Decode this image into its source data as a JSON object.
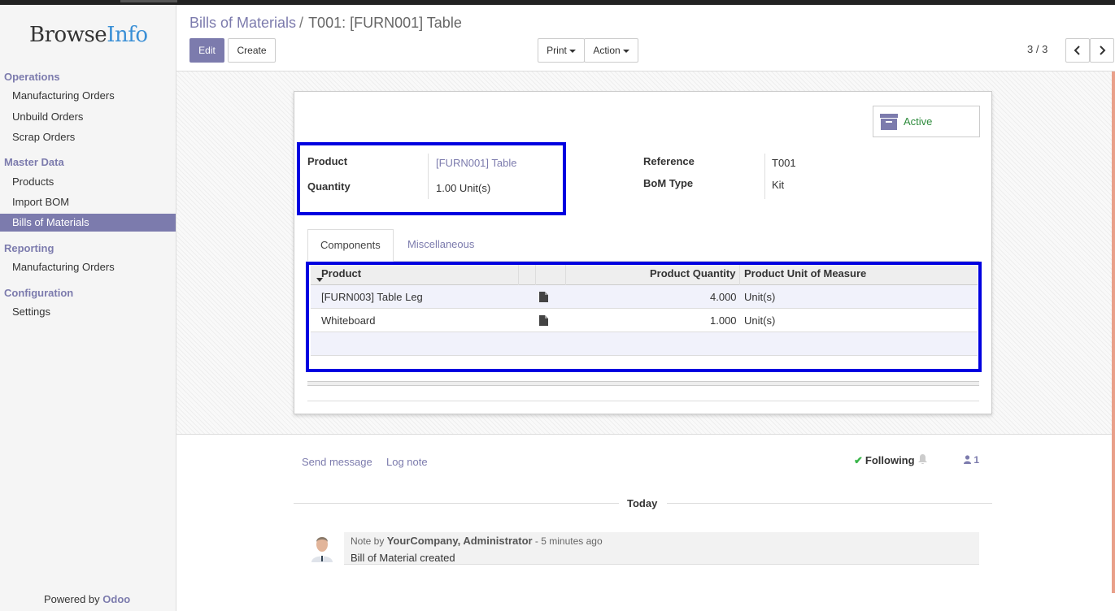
{
  "brand": {
    "name_part1": "Browse",
    "name_part2": "Info"
  },
  "sidebar": {
    "sections": [
      {
        "title": "Operations",
        "items": [
          "Manufacturing Orders",
          "Unbuild Orders",
          "Scrap Orders"
        ]
      },
      {
        "title": "Master Data",
        "items": [
          "Products",
          "Import BOM",
          "Bills of Materials"
        ]
      },
      {
        "title": "Reporting",
        "items": [
          "Manufacturing Orders"
        ]
      },
      {
        "title": "Configuration",
        "items": [
          "Settings"
        ]
      }
    ],
    "active_item": "Bills of Materials",
    "powered_prefix": "Powered by ",
    "powered_brand": "Odoo"
  },
  "breadcrumb": {
    "parent": "Bills of Materials",
    "separator": "/",
    "current": "T001: [FURN001] Table"
  },
  "toolbar": {
    "edit": "Edit",
    "create": "Create",
    "print": "Print",
    "action": "Action"
  },
  "pager": {
    "text": "3 / 3"
  },
  "form": {
    "status_button": "Active",
    "fields": {
      "product_label": "Product",
      "product_value": "[FURN001] Table",
      "quantity_label": "Quantity",
      "quantity_value": "1.00 Unit(s)",
      "reference_label": "Reference",
      "reference_value": "T001",
      "bom_type_label": "BoM Type",
      "bom_type_value": "Kit"
    },
    "tabs": [
      "Components",
      "Miscellaneous"
    ],
    "table": {
      "headers": [
        "Product",
        "Product Quantity",
        "Product Unit of Measure"
      ],
      "rows": [
        {
          "product": "[FURN003] Table Leg",
          "qty": "4.000",
          "uom": "Unit(s)"
        },
        {
          "product": "Whiteboard",
          "qty": "1.000",
          "uom": "Unit(s)"
        }
      ]
    }
  },
  "chatter": {
    "send_message": "Send message",
    "log_note": "Log note",
    "following": "Following",
    "followers_count": "1",
    "date_separator": "Today",
    "message": {
      "prefix": "Note by ",
      "author": "YourCompany, Administrator",
      "time": " - 5 minutes ago",
      "body": "Bill of Material created"
    }
  },
  "colors": {
    "brand": "#7c7bad",
    "highlight": "#0000e0",
    "active_status": "#2e8b3c",
    "following_check": "#3ab54a"
  }
}
